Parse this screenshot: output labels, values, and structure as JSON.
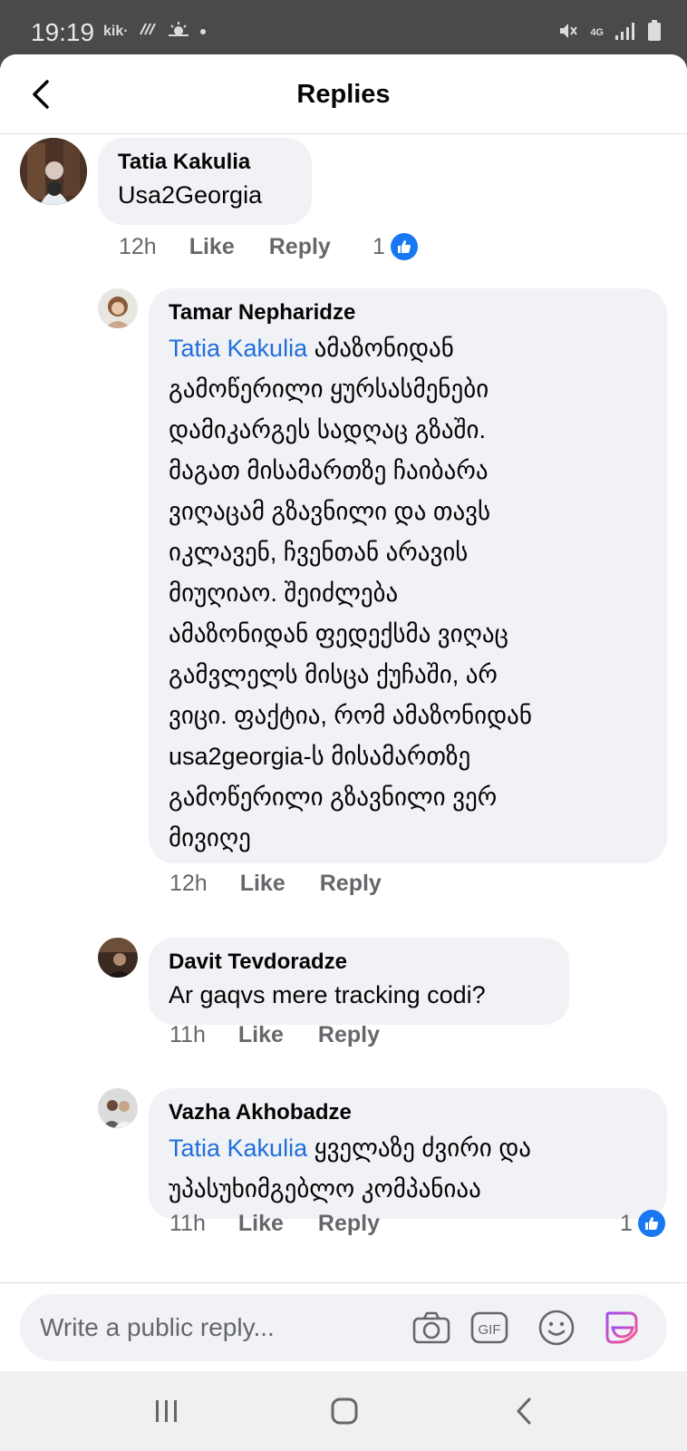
{
  "status_bar": {
    "time": "19:19",
    "left_icons": [
      "kik-icon",
      "tv-signal-icon",
      "weather-icon",
      "dot-icon"
    ],
    "kik_label": "kik·",
    "right_icons": [
      "mute-icon",
      "4g-icon",
      "signal-icon",
      "battery-icon"
    ],
    "network_label": "4G"
  },
  "header": {
    "title": "Replies"
  },
  "comments": [
    {
      "author": "Tatia Kakulia",
      "text": "Usa2Georgia",
      "time": "12h",
      "like_label": "Like",
      "reply_label": "Reply",
      "reaction_count": "1"
    },
    {
      "author": "Tamar Nepharidze",
      "mention": "Tatia Kakulia",
      "lines": [
        " ამაზონიდან",
        "გამოწერილი ყურსასმენები",
        "დამიკარგეს სადღაც გზაში.",
        "მაგათ მისამართზე ჩაიბარა",
        "ვიღაცამ გზავნილი და თავს",
        "იკლავენ, ჩვენთან არავის",
        "მიუღიაო. შეიძლება",
        "ამაზონიდან ფედექსმა ვიღაც",
        "გამვლელს მისცა ქუჩაში, არ",
        "ვიცი. ფაქტია, რომ ამაზონიდან",
        "usa2georgia-ს მისამართზე",
        "გამოწერილი გზავნილი ვერ",
        "მივიღე"
      ],
      "time": "12h",
      "like_label": "Like",
      "reply_label": "Reply"
    },
    {
      "author": "Davit Tevdoradze",
      "text": "Ar gaqvs mere tracking codi?",
      "time": "11h",
      "like_label": "Like",
      "reply_label": "Reply"
    },
    {
      "author": "Vazha Akhobadze",
      "mention": "Tatia Kakulia",
      "lines": [
        " ყველაზე ძვირი და",
        "უპასუხიმგებლო კომპანიაა"
      ],
      "time": "11h",
      "like_label": "Like",
      "reply_label": "Reply",
      "reaction_count": "1"
    }
  ],
  "composer": {
    "placeholder": "Write a public reply...",
    "icons": [
      "camera-icon",
      "gif-icon",
      "emoji-icon",
      "sticker-icon"
    ],
    "gif_label": "GIF"
  },
  "nav": {
    "icons": [
      "recent-apps-icon",
      "home-icon",
      "back-nav-icon"
    ]
  },
  "colors": {
    "mention": "#216fdb",
    "like_badge": "#1877f2",
    "bubble": "#f0f2f5",
    "meta_text": "#65676b"
  }
}
